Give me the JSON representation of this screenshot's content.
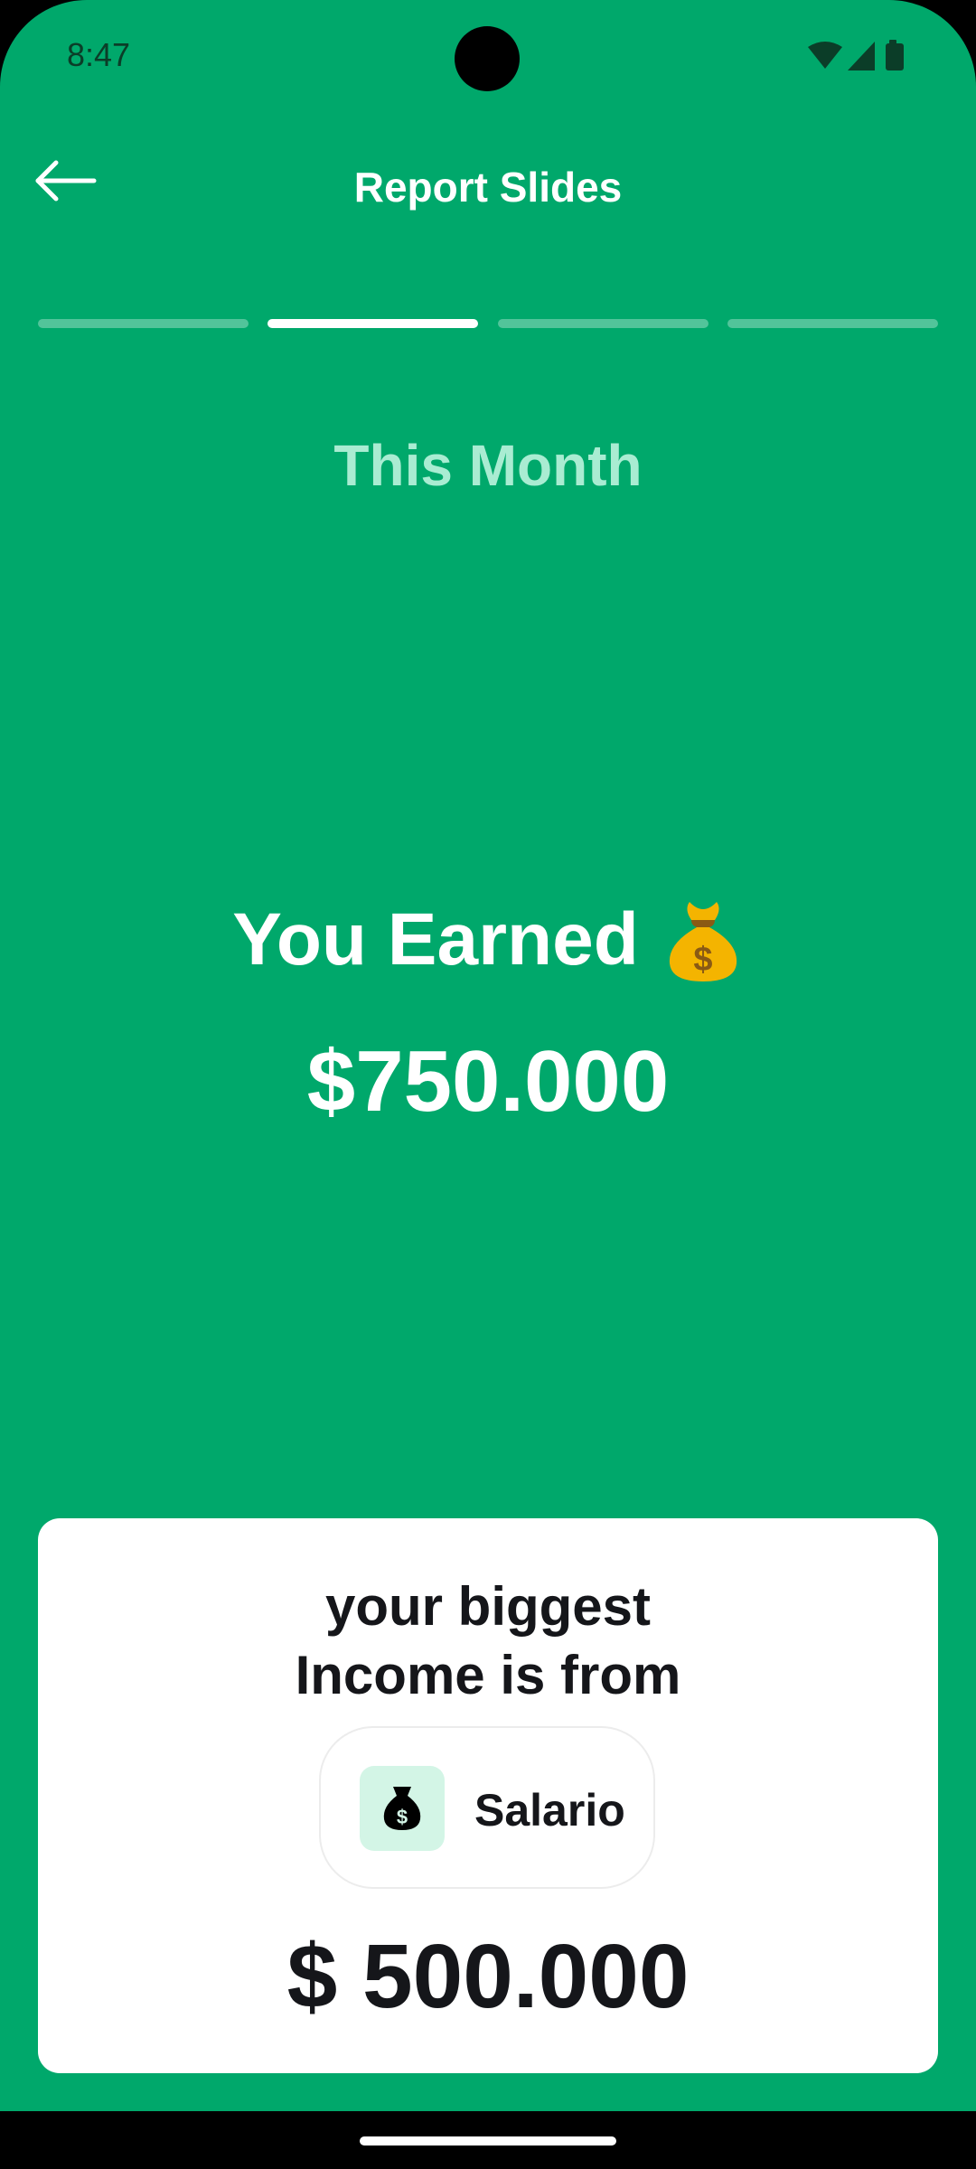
{
  "status_bar": {
    "time": "8:47",
    "icons": [
      "wifi-icon",
      "signal-icon",
      "battery-icon"
    ]
  },
  "app_bar": {
    "back_icon": "arrow-left-icon",
    "title": "Report Slides"
  },
  "slides_progress": {
    "total": 4,
    "current": 2
  },
  "slide": {
    "period": "This Month",
    "earned_label": "You Earned",
    "earned_emoji": "money-bag-icon",
    "earned_amount": "$750.000"
  },
  "biggest_income_card": {
    "heading_line1": "your biggest",
    "heading_line2": "Income is from",
    "source_icon": "money-bag-icon",
    "source_name": "Salario",
    "amount": "$ 500.000"
  },
  "colors": {
    "background": "#00a86b",
    "progress_active": "#ffffff",
    "period_text": "#a9ecd2",
    "chip_icon_bg": "#d3f5e6",
    "card_text": "#15161a"
  }
}
